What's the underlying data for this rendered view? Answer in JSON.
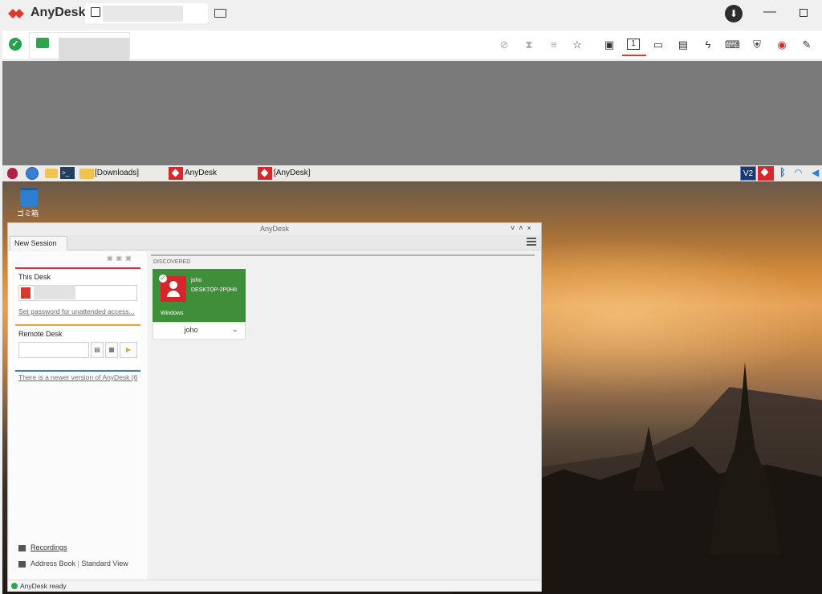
{
  "app": {
    "name": "AnyDesk"
  },
  "title_bar": {
    "download_icon": "download-icon",
    "minimize_label": "—"
  },
  "toolbar": {
    "icons": [
      "disable-display-icon",
      "hourglass-icon",
      "database-icon",
      "star-icon",
      "file-transfer-icon",
      "monitor-1-icon",
      "display-icon",
      "chat-icon",
      "action-icon",
      "keyboard-icon",
      "permissions-icon",
      "record-icon",
      "whiteboard-icon"
    ],
    "active_monitor": "1"
  },
  "taskbar": {
    "items": [
      "[Downloads]",
      "AnyDesk",
      "[AnyDesk]"
    ],
    "tray_vnc": "V2"
  },
  "desktop": {
    "trash_label": "ゴミ箱"
  },
  "inner_window": {
    "title": "AnyDesk",
    "tab": "New Session",
    "this_desk": {
      "title": "This Desk",
      "link": "Set password for unattended access..."
    },
    "remote_desk": {
      "title": "Remote Desk"
    },
    "news_link": "There is a newer version of AnyDesk (6",
    "discovered": {
      "header": "DISCOVERED",
      "name": "joho",
      "host": "DESKTOP-2P0HII",
      "os": "Windows",
      "footer_label": "joho"
    },
    "bottom": {
      "recordings": "Recordings",
      "address_book": "Address Book",
      "standard_view": "Standard View"
    },
    "status": "AnyDesk ready"
  },
  "colors": {
    "brand_red": "#d8262b",
    "ok_green": "#21a34a",
    "remote_grey": "#7a7a7a"
  }
}
